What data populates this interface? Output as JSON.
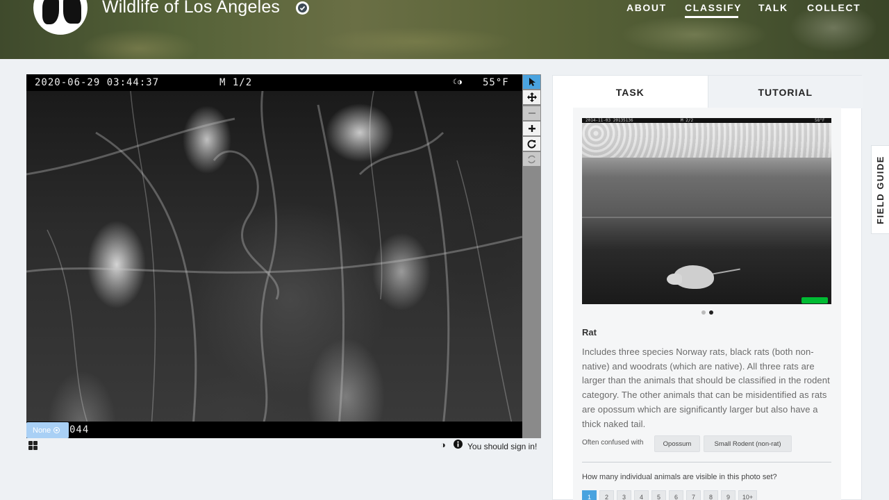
{
  "header": {
    "title": "Wildlife of Los Angeles",
    "nav": [
      {
        "label": "ABOUT"
      },
      {
        "label": "CLASSIFY",
        "active": true
      },
      {
        "label": "TALK"
      },
      {
        "label": "COLLECT"
      }
    ]
  },
  "viewer": {
    "timestamp": "2020-06-29 03:44:37",
    "frame": "M 1/2",
    "temperature": "55°F",
    "bottom_code": "044",
    "none_badge": "None",
    "sign_in_text": "You should sign in!",
    "tools": [
      "pointer-icon",
      "pan-icon",
      "zoom-out-icon",
      "zoom-in-icon",
      "rotate-icon",
      "reset-icon"
    ]
  },
  "panel": {
    "tabs": [
      {
        "label": "TASK",
        "active": true
      },
      {
        "label": "TUTORIAL"
      }
    ],
    "field_guide_label": "FIELD GUIDE",
    "guide_photo": {
      "timestamp": "2014-11-03 20135136",
      "frame": "M 2/2",
      "temp": "58°F"
    },
    "animal": {
      "name": "Rat",
      "description": "Includes three species Norway rats, black rats (both non-native) and woodrats (which are native). All three rats are larger than the animals that should be classified in the rodent category. The other animals that can be misidentified as rats are opossum which are significantly larger but also have a thick naked tail.",
      "confused_label": "Often confused with",
      "confused_with": [
        "Opossum",
        "Small Rodent (non-rat)"
      ]
    },
    "question": "How many individual animals are visible in this photo set?",
    "counts": [
      "1",
      "2",
      "3",
      "4",
      "5",
      "6",
      "7",
      "8",
      "9",
      "10+"
    ]
  },
  "colors": {
    "accent": "#4aa3df",
    "background": "#eef1f4"
  }
}
